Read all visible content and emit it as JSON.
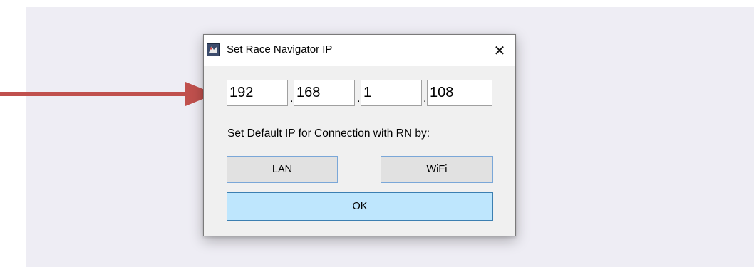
{
  "dialog": {
    "title": "Set Race Navigator IP",
    "close_glyph": "✕",
    "app_icon": "race-navigator-app-icon",
    "ip_octets": [
      "192",
      "168",
      "1",
      "108"
    ],
    "separator": ".",
    "prompt": "Set Default IP for Connection with RN by:",
    "lan_label": "LAN",
    "wifi_label": "WiFi",
    "ok_label": "OK"
  },
  "annotation": {
    "arrow_color": "#c0504d",
    "arrow_icon": "right-arrow-icon"
  },
  "colors": {
    "panel_bg": "#eeedf4",
    "ok_button_bg": "#bee6fd",
    "button_bg": "#e1e1e1"
  }
}
